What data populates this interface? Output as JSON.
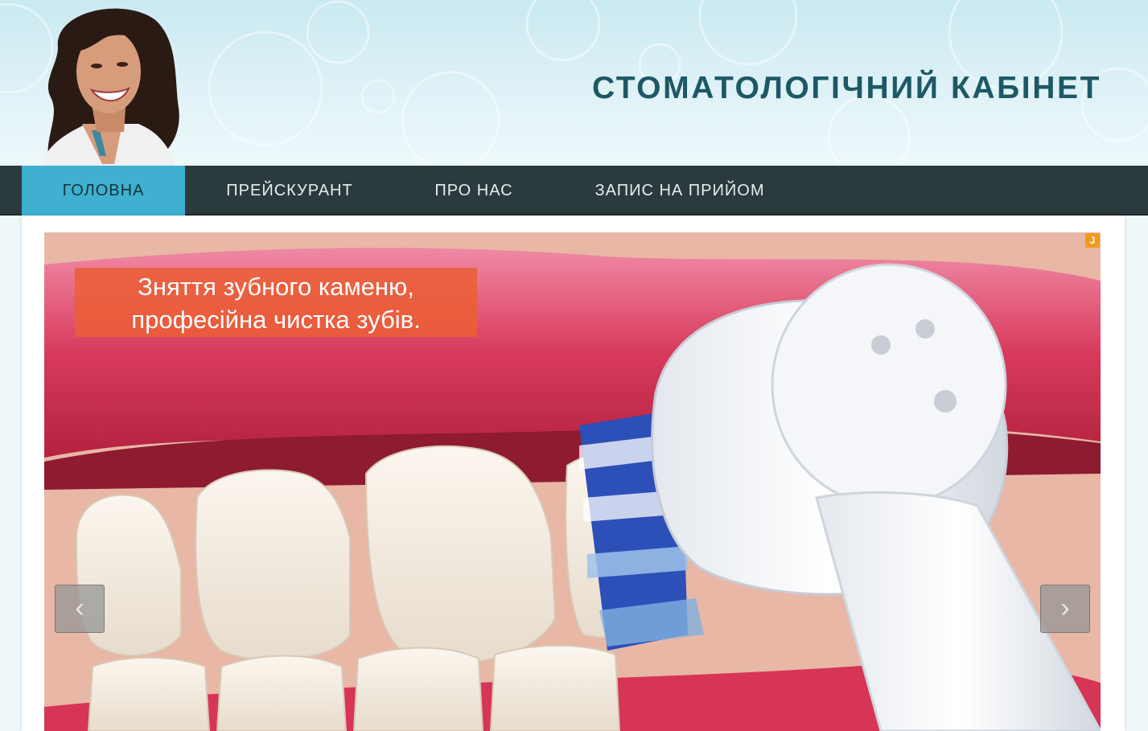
{
  "header": {
    "title": "СТОМАТОЛОГІЧНИЙ КАБІНЕТ"
  },
  "nav": {
    "items": [
      {
        "label": "ГОЛОВНА",
        "active": true
      },
      {
        "label": "ПРЕЙСКУРАНТ",
        "active": false
      },
      {
        "label": "ПРО НАС",
        "active": false
      },
      {
        "label": "ЗАПИС НА ПРИЙОМ",
        "active": false
      }
    ]
  },
  "slider": {
    "caption_line1": "Зняття зубного каменю,",
    "caption_line2": "професійна чистка зубів.",
    "prev_icon": "chevron-left-icon",
    "next_icon": "chevron-right-icon",
    "badge": "J"
  },
  "colors": {
    "title": "#1d5866",
    "nav_bg": "#2b3a3c",
    "nav_active": "#3fb0d0",
    "caption_bg": "#eb5e34",
    "badge": "#f39a1e"
  }
}
